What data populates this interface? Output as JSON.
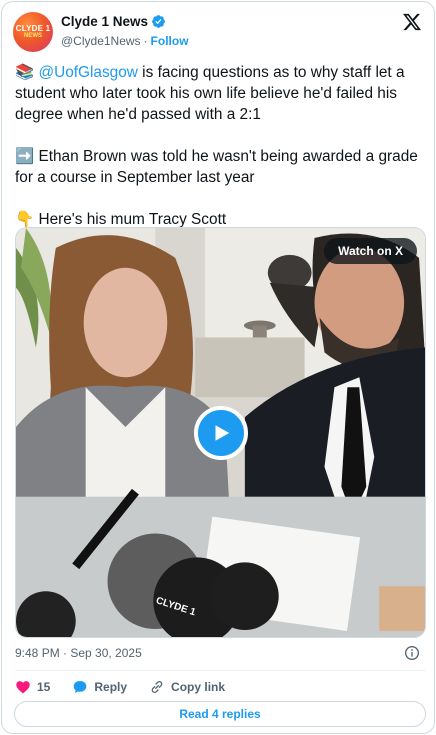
{
  "account": {
    "display_name": "Clyde 1 News",
    "handle": "@Clyde1News",
    "separator": "·",
    "follow_label": "Follow",
    "avatar_text_line1": "CLYDE 1",
    "avatar_text_line2": "NEWS"
  },
  "tweet": {
    "para1_emoji": "📚",
    "para1_mention": "@UofGlasgow",
    "para1_text": " is facing questions as to why staff let a student who later took his own life believe he'd failed his degree when he'd passed with a 2:1",
    "para2_emoji": "➡️",
    "para2_text": " Ethan Brown was told he wasn't being awarded a grade for a course in September last year",
    "para3_emoji": "👇",
    "para3_text": " Here's his mum Tracy Scott"
  },
  "media": {
    "watch_label": "Watch on X",
    "mic_brand": "CLYDE 1"
  },
  "footer": {
    "timestamp": "9:48 PM · Sep 30, 2025",
    "like_count": "15",
    "reply_label": "Reply",
    "copy_link_label": "Copy link",
    "read_replies_label": "Read 4 replies"
  },
  "colors": {
    "accent": "#1d9bf0",
    "like": "#f91880",
    "text_secondary": "#536471"
  }
}
